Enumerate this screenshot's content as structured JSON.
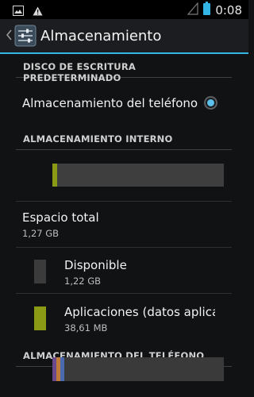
{
  "status_bar": {
    "time": "0:08",
    "icons": [
      "image-icon",
      "warning-icon",
      "signal-icon",
      "battery-icon"
    ]
  },
  "action_bar": {
    "title": "Almacenamiento",
    "accent": "#33b5e5"
  },
  "sections": {
    "default_disk": {
      "header": "DISCO DE ESCRITURA PREDETERMINADO",
      "option_label": "Almacenamiento del teléfono",
      "selected": true
    },
    "internal": {
      "header": "ALMACENAMIENTO INTERNO",
      "usage": {
        "apps_fraction": 0.03,
        "available_fraction": 0.97
      },
      "total_label": "Espacio total",
      "total_value": "1,27 GB",
      "items": [
        {
          "label": "Disponible",
          "value": "1,22 GB",
          "color": "#3b3b3b"
        },
        {
          "label": "Aplicaciones (datos aplicaci",
          "value": "38,61 MB",
          "color": "#8a9a15"
        }
      ]
    },
    "phone": {
      "header": "ALMACENAMIENTO DEL TELÉFONO",
      "usage_colors": [
        "#6a4a8a",
        "#c07a3a",
        "#4a6ab0"
      ]
    }
  }
}
